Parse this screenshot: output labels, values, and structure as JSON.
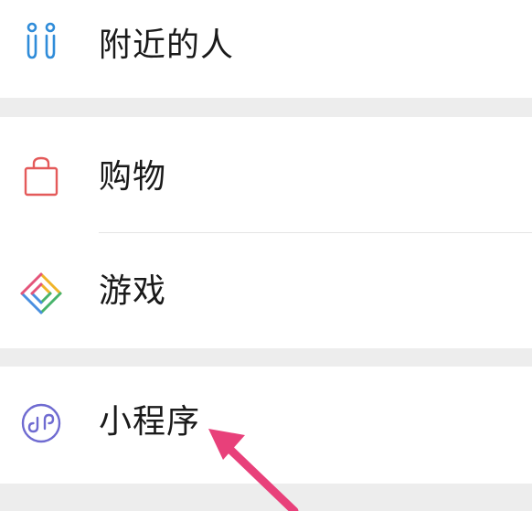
{
  "menu": {
    "groups": [
      {
        "items": [
          {
            "icon": "people-nearby-icon",
            "label": "附近的人"
          }
        ]
      },
      {
        "items": [
          {
            "icon": "shopping-bag-icon",
            "label": "购物"
          },
          {
            "icon": "games-diamond-icon",
            "label": "游戏"
          }
        ]
      },
      {
        "items": [
          {
            "icon": "mini-programs-icon",
            "label": "小程序"
          }
        ]
      }
    ]
  },
  "annotation": {
    "arrow_color": "#e8407a",
    "target": "mini-programs"
  },
  "colors": {
    "people_icon": "#2f8cd9",
    "shopping_icon": "#e45a5a",
    "mini_program_icon": "#6f6bd1",
    "background": "#ededed",
    "card": "#ffffff"
  }
}
